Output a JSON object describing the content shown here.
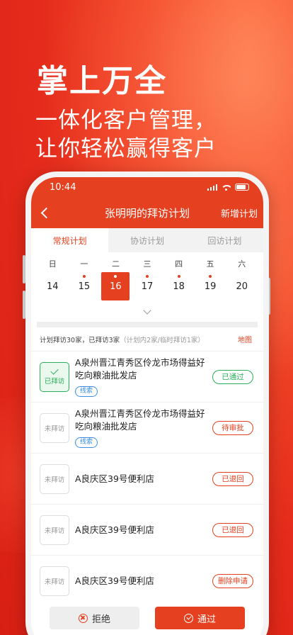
{
  "promo": {
    "headline": "掌上万全",
    "subline_1": "一体化客户管理，",
    "subline_2": "让你轻松赢得客户"
  },
  "status_bar": {
    "time": "10:44"
  },
  "nav": {
    "title": "张明明的拜访计划",
    "action": "新增计划",
    "back_icon": "chevron-left-icon"
  },
  "tabs": [
    {
      "label": "常规计划",
      "active": true
    },
    {
      "label": "协访计划",
      "active": false
    },
    {
      "label": "回访计划",
      "active": false
    }
  ],
  "calendar": {
    "weekdays": [
      "日",
      "一",
      "二",
      "三",
      "四",
      "五",
      "六"
    ],
    "dates": [
      {
        "day": "14",
        "has_plan": false,
        "selected": false
      },
      {
        "day": "15",
        "has_plan": true,
        "selected": false
      },
      {
        "day": "16",
        "has_plan": true,
        "selected": true
      },
      {
        "day": "17",
        "has_plan": true,
        "selected": false
      },
      {
        "day": "18",
        "has_plan": true,
        "selected": false
      },
      {
        "day": "19",
        "has_plan": true,
        "selected": false
      },
      {
        "day": "20",
        "has_plan": false,
        "selected": false
      }
    ]
  },
  "summary": {
    "text": "计划拜访30家，已拜访3家",
    "detail": "（计划内2家/临时拜访1家）",
    "map_link": "地图"
  },
  "visits": [
    {
      "status": "已拜访",
      "visited": true,
      "name": "A泉州晋江青秀区伶龙市场得益好吃向粮油批发店",
      "tag": "线索",
      "result": "已通过",
      "result_color": "green"
    },
    {
      "status": "未拜访",
      "visited": false,
      "name": "A泉州晋江青秀区伶龙市场得益好吃向粮油批发店",
      "tag": "线索",
      "result": "待审批",
      "result_color": "red"
    },
    {
      "status": "未拜访",
      "visited": false,
      "name": "A良庆区39号便利店",
      "tag": "",
      "result": "已退回",
      "result_color": "red"
    },
    {
      "status": "未拜访",
      "visited": false,
      "name": "A良庆区39号便利店",
      "tag": "",
      "result": "已退回",
      "result_color": "red"
    },
    {
      "status": "未拜访",
      "visited": false,
      "name": "A良庆区39号便利店",
      "tag": "",
      "result": "删除申请",
      "result_color": "red"
    }
  ],
  "actions": {
    "reject": "拒绝",
    "approve": "通过"
  },
  "colors": {
    "brand": "#e5401f",
    "approved": "#2bb05a",
    "tag": "#3a8ee6"
  }
}
